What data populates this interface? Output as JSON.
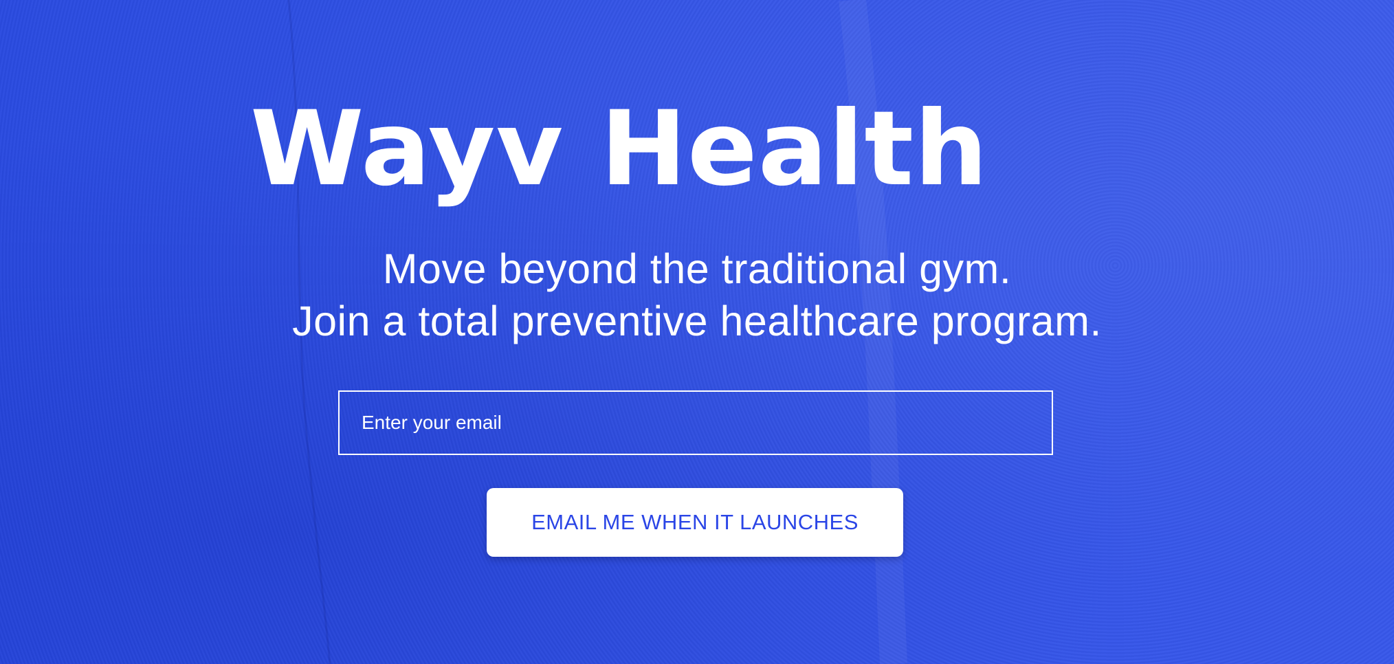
{
  "colors": {
    "background": "#3050e4",
    "text": "#ffffff",
    "button_background": "#ffffff",
    "button_text": "#2a45e6"
  },
  "hero": {
    "title": "Wayv Health",
    "subtitle_line1": "Move beyond the traditional gym.",
    "subtitle_line2": "Join a total preventive healthcare program."
  },
  "signup": {
    "email_placeholder": "Enter your email",
    "email_value": "",
    "button_label": "EMAIL ME WHEN IT LAUNCHES"
  }
}
